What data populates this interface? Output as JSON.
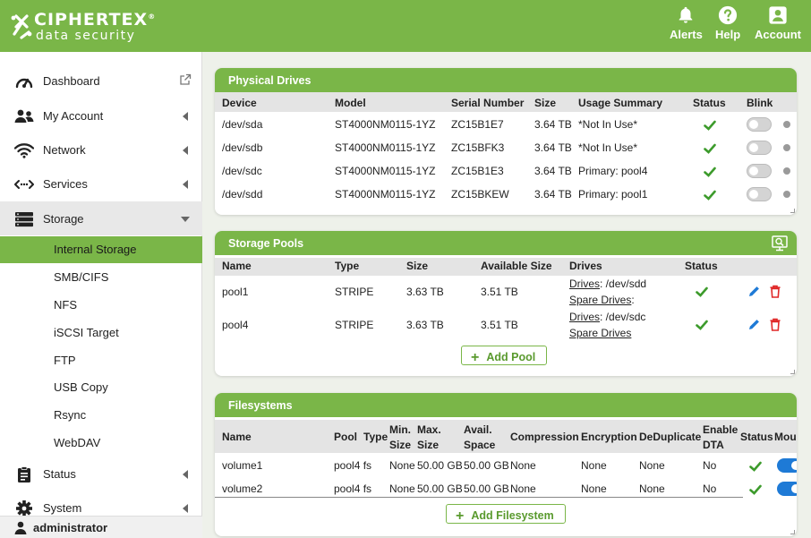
{
  "brand": {
    "name": "CIPHERTEX",
    "registered": "®",
    "tagline": "data security",
    "accent": "#7ab648"
  },
  "topbar": {
    "alerts": {
      "label": "Alerts",
      "icon": "bell-icon"
    },
    "help": {
      "label": "Help",
      "icon": "question-icon"
    },
    "account": {
      "label": "Account",
      "icon": "account-icon"
    }
  },
  "sidebar": {
    "items": [
      {
        "label": "Dashboard",
        "icon": "gauge-icon"
      },
      {
        "label": "My Account",
        "icon": "users-icon"
      },
      {
        "label": "Network",
        "icon": "wifi-icon"
      },
      {
        "label": "Services",
        "icon": "code-arrows-icon"
      },
      {
        "label": "Storage",
        "icon": "storage-icon"
      },
      {
        "label": "Status",
        "icon": "clipboard-icon"
      },
      {
        "label": "System",
        "icon": "gear-icon"
      }
    ],
    "storage_sub": [
      "Internal Storage",
      "SMB/CIFS",
      "NFS",
      "iSCSI Target",
      "FTP",
      "USB Copy",
      "Rsync",
      "WebDAV"
    ],
    "user": "administrator"
  },
  "physical_drives": {
    "title": "Physical Drives",
    "columns": [
      "Device",
      "Model",
      "Serial Number",
      "Size",
      "Usage Summary",
      "Status",
      "Blink"
    ],
    "rows": [
      {
        "device": "/dev/sda",
        "model": "ST4000NM0115-1YZ",
        "serial": "ZC15B1E7",
        "size": "3.64 TB",
        "usage": "*Not In Use*"
      },
      {
        "device": "/dev/sdb",
        "model": "ST4000NM0115-1YZ",
        "serial": "ZC15BFK3",
        "size": "3.64 TB",
        "usage": "*Not In Use*"
      },
      {
        "device": "/dev/sdc",
        "model": "ST4000NM0115-1YZ",
        "serial": "ZC15B1E3",
        "size": "3.64 TB",
        "usage": "Primary: pool4"
      },
      {
        "device": "/dev/sdd",
        "model": "ST4000NM0115-1YZ",
        "serial": "ZC15BKEW",
        "size": "3.64 TB",
        "usage": "Primary: pool1"
      }
    ]
  },
  "storage_pools": {
    "title": "Storage Pools",
    "columns": [
      "Name",
      "Type",
      "Size",
      "Available Size",
      "Drives",
      "Status"
    ],
    "drives_label": "Drives",
    "spare_label": "Spare Drives",
    "rows": [
      {
        "name": "pool1",
        "type": "STRIPE",
        "size": "3.63 TB",
        "available": "3.51 TB",
        "drives": ": /dev/sdd",
        "spare": ":"
      },
      {
        "name": "pool4",
        "type": "STRIPE",
        "size": "3.63 TB",
        "available": "3.51 TB",
        "drives": ": /dev/sdc",
        "spare": ""
      }
    ],
    "add_label": "Add Pool"
  },
  "filesystems": {
    "title": "Filesystems",
    "columns": {
      "name": "Name",
      "pool": "Pool",
      "type": "Type",
      "min_size": [
        "Min.",
        "Size"
      ],
      "max_size": [
        "Max.",
        "Size"
      ],
      "avail_space": [
        "Avail.",
        "Space"
      ],
      "compression": "Compression",
      "encryption": "Encryption",
      "dedup": "DeDuplicate",
      "dta": [
        "Enable",
        "DTA"
      ],
      "status": "Status",
      "mount": "Mou"
    },
    "rows": [
      {
        "name": "volume1",
        "pool": "pool4",
        "type": "fs",
        "min": "None",
        "max": "50.00 GB",
        "avail": "50.00 GB",
        "compression": "None",
        "encryption": "None",
        "dedup": "None",
        "dta": "No"
      },
      {
        "name": "volume2",
        "pool": "pool4",
        "type": "fs",
        "min": "None",
        "max": "50.00 GB",
        "avail": "50.00 GB",
        "compression": "None",
        "encryption": "None",
        "dedup": "None",
        "dta": "No"
      }
    ],
    "add_label": "Add Filesystem"
  }
}
